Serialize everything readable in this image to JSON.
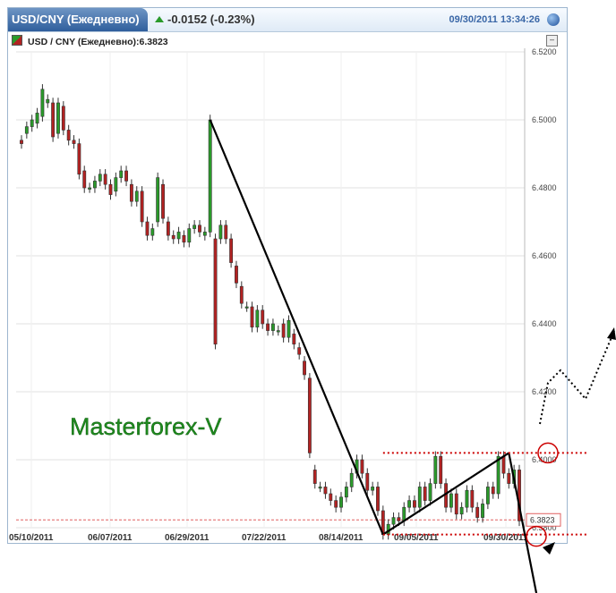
{
  "header": {
    "tab_label": "USD/CNY (Ежедневно)",
    "change": "-0.0152 (-0.23%)",
    "datetime": "09/30/2011 13:34:26"
  },
  "legend": {
    "label": "USD / CNY (Ежедневно):6.3823"
  },
  "minimize_label": "–",
  "watermark": "Masterforex-V",
  "colors": {
    "up": "#2a9a2a",
    "down": "#b22222",
    "accent": "#3a67a7",
    "level": "#cc0000"
  },
  "chart_data": {
    "type": "candlestick",
    "x_ticks": [
      "05/10/2011",
      "06/07/2011",
      "06/29/2011",
      "07/22/2011",
      "08/14/2011",
      "09/05/2011",
      "09/30/2011"
    ],
    "y_ticks": [
      "6.5200",
      "6.5000",
      "6.4800",
      "6.4600",
      "6.4400",
      "6.4200",
      "6.4000",
      "6.3823",
      "6.3800"
    ],
    "ylim": [
      6.38,
      6.52
    ],
    "last_price": 6.3823,
    "last_price_label": "6.3823",
    "grid": true,
    "candles": [
      [
        6.494,
        6.493,
        6.492
      ],
      [
        6.496,
        6.498,
        6.497
      ],
      [
        6.498,
        6.5,
        6.499
      ],
      [
        6.499,
        6.502,
        6.501
      ],
      [
        6.501,
        6.509,
        6.508
      ],
      [
        6.505,
        6.506,
        6.505
      ],
      [
        6.505,
        6.495,
        6.495
      ],
      [
        6.496,
        6.505,
        6.504
      ],
      [
        6.504,
        6.497,
        6.497
      ],
      [
        6.497,
        6.494,
        6.494
      ],
      [
        6.494,
        6.493,
        6.493
      ],
      [
        6.493,
        6.484,
        6.484
      ],
      [
        6.485,
        6.48,
        6.48
      ],
      [
        6.48,
        6.48,
        6.48
      ],
      [
        6.48,
        6.482,
        6.482
      ],
      [
        6.482,
        6.484,
        6.484
      ],
      [
        6.484,
        6.481,
        6.481
      ],
      [
        6.481,
        6.478,
        6.478
      ],
      [
        6.479,
        6.483,
        6.483
      ],
      [
        6.483,
        6.485,
        6.485
      ],
      [
        6.485,
        6.482,
        6.482
      ],
      [
        6.481,
        6.476,
        6.476
      ],
      [
        6.476,
        6.479,
        6.479
      ],
      [
        6.479,
        6.47,
        6.47
      ],
      [
        6.47,
        6.466,
        6.466
      ],
      [
        6.466,
        6.468,
        6.468
      ],
      [
        6.47,
        6.483,
        6.483
      ],
      [
        6.481,
        6.471,
        6.471
      ],
      [
        6.47,
        6.466,
        6.466
      ],
      [
        6.466,
        6.465,
        6.465
      ],
      [
        6.465,
        6.467,
        6.467
      ],
      [
        6.466,
        6.464,
        6.464
      ],
      [
        6.464,
        6.468,
        6.468
      ],
      [
        6.468,
        6.469,
        6.469
      ],
      [
        6.469,
        6.467,
        6.467
      ],
      [
        6.466,
        6.467,
        6.467
      ],
      [
        6.467,
        6.5,
        6.5
      ],
      [
        6.465,
        6.434,
        6.434
      ],
      [
        6.465,
        6.469,
        6.469
      ],
      [
        6.469,
        6.465,
        6.465
      ],
      [
        6.465,
        6.458,
        6.458
      ],
      [
        6.457,
        6.452,
        6.452
      ],
      [
        6.451,
        6.446,
        6.446
      ],
      [
        6.445,
        6.445,
        6.445
      ],
      [
        6.445,
        6.439,
        6.439
      ],
      [
        6.439,
        6.444,
        6.444
      ],
      [
        6.444,
        6.44,
        6.44
      ],
      [
        6.44,
        6.438,
        6.438
      ],
      [
        6.438,
        6.44,
        6.44
      ],
      [
        6.438,
        6.438,
        6.438
      ],
      [
        6.44,
        6.436,
        6.436
      ],
      [
        6.436,
        6.441,
        6.441
      ],
      [
        6.437,
        6.434,
        6.434
      ],
      [
        6.433,
        6.431,
        6.431
      ],
      [
        6.429,
        6.425,
        6.425
      ],
      [
        6.424,
        6.402,
        6.402
      ],
      [
        6.397,
        6.393,
        6.393
      ],
      [
        6.392,
        6.392,
        6.392
      ],
      [
        6.392,
        6.39,
        6.39
      ],
      [
        6.39,
        6.388,
        6.388
      ],
      [
        6.388,
        6.386,
        6.386
      ],
      [
        6.386,
        6.389,
        6.389
      ],
      [
        6.389,
        6.392,
        6.392
      ],
      [
        6.392,
        6.396,
        6.396
      ],
      [
        6.396,
        6.4,
        6.4
      ],
      [
        6.4,
        6.396,
        6.396
      ],
      [
        6.396,
        6.391,
        6.391
      ],
      [
        6.391,
        6.392,
        6.392
      ],
      [
        6.392,
        6.385,
        6.385
      ],
      [
        6.385,
        6.378,
        6.378
      ],
      [
        6.378,
        6.381,
        6.381
      ],
      [
        6.381,
        6.383,
        6.383
      ],
      [
        6.383,
        6.382,
        6.382
      ],
      [
        6.382,
        6.386,
        6.386
      ],
      [
        6.386,
        6.388,
        6.388
      ],
      [
        6.388,
        6.386,
        6.386
      ],
      [
        6.386,
        6.392,
        6.392
      ],
      [
        6.392,
        6.388,
        6.388
      ],
      [
        6.388,
        6.393,
        6.393
      ],
      [
        6.393,
        6.401,
        6.401
      ],
      [
        6.401,
        6.393,
        6.393
      ],
      [
        6.393,
        6.386,
        6.386
      ],
      [
        6.386,
        6.39,
        6.39
      ],
      [
        6.39,
        6.384,
        6.384
      ],
      [
        6.384,
        6.386,
        6.386
      ],
      [
        6.386,
        6.391,
        6.391
      ],
      [
        6.391,
        6.386,
        6.386
      ],
      [
        6.386,
        6.383,
        6.383
      ],
      [
        6.383,
        6.387,
        6.387
      ],
      [
        6.387,
        6.392,
        6.392
      ],
      [
        6.392,
        6.39,
        6.39
      ],
      [
        6.39,
        6.401,
        6.401
      ],
      [
        6.401,
        6.396,
        6.396
      ],
      [
        6.396,
        6.393,
        6.393
      ],
      [
        6.393,
        6.397,
        6.397
      ],
      [
        6.397,
        6.382,
        6.382
      ]
    ],
    "candle_fields": [
      "open",
      "close",
      "_unused"
    ],
    "annotations": {
      "trend_lines": [
        {
          "from": [
            36,
            6.5
          ],
          "to": [
            69,
            6.378
          ]
        },
        {
          "from": [
            69,
            6.378
          ],
          "to": [
            93,
            6.402
          ]
        },
        {
          "from": [
            93,
            6.402
          ],
          "to": [
            100,
            6.37
          ]
        }
      ],
      "levels": [
        6.402,
        6.378
      ]
    }
  }
}
